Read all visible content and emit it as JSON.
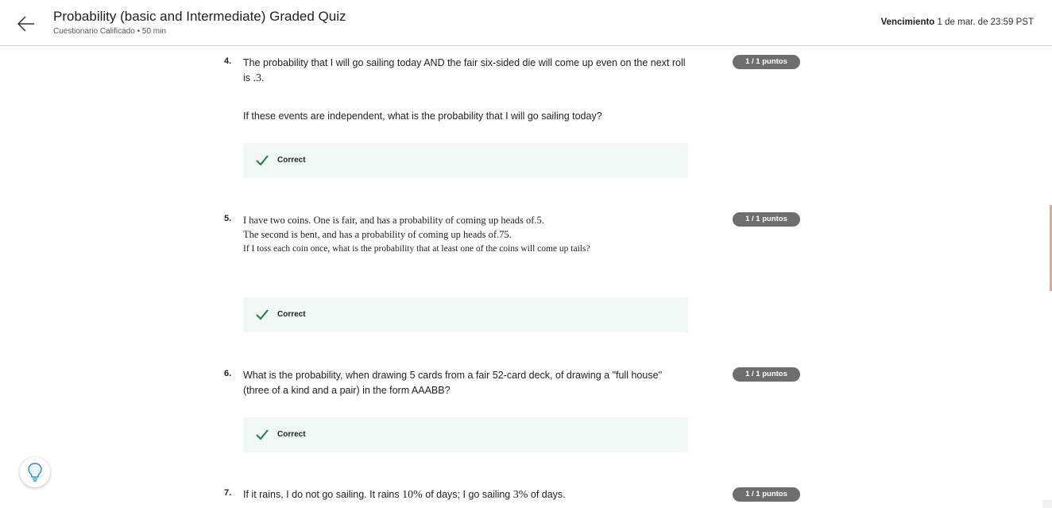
{
  "header": {
    "title": "Probability (basic and Intermediate) Graded Quiz",
    "subtitle": "Cuestionario Calificado • 50 min",
    "due_label": "Vencimiento",
    "due_value": "1 de mar. de 23:59 PST",
    "back_icon": "arrow-left-icon"
  },
  "questions": [
    {
      "number": "4.",
      "text_a": "The probability that I will go sailing today AND the fair six-sided die will come up even on the next roll is ",
      "math_a": ".3",
      "text_a_end": ".",
      "text_b": "If these events are independent, what is the probability that I will go sailing today?",
      "points": "1 / 1 puntos",
      "feedback": "Correct"
    },
    {
      "number": "5.",
      "line1": "I have two coins. One is fair, and has a probability of coming up heads of.5.",
      "line2": "The second is bent, and has a probability of coming up heads of.75.",
      "line3": "If I toss each coin once, what is the probability that at least one of the coins will come up tails?",
      "points": "1 / 1 puntos",
      "feedback": "Correct"
    },
    {
      "number": "6.",
      "text": "What is the probability, when drawing 5 cards from a fair 52-card deck, of drawing a \"full house'' (three of a kind and a pair) in the form AAABB?",
      "points": "1 / 1 puntos",
      "feedback": "Correct"
    },
    {
      "number": "7.",
      "text_a": "If it rains, I do not go sailing. It rains ",
      "math_a": "10%",
      "text_b": " of days; I go sailing ",
      "math_b": "3%",
      "text_c": " of days.",
      "points": "1 / 1 puntos"
    }
  ],
  "icons": {
    "check": "check-icon",
    "bulb": "lightbulb-icon"
  },
  "colors": {
    "correct_bg": "#f1f7f4",
    "check_green": "#1d7c50",
    "badge_bg": "#6e6e6e",
    "scroll_accent": "#f0a27a"
  }
}
